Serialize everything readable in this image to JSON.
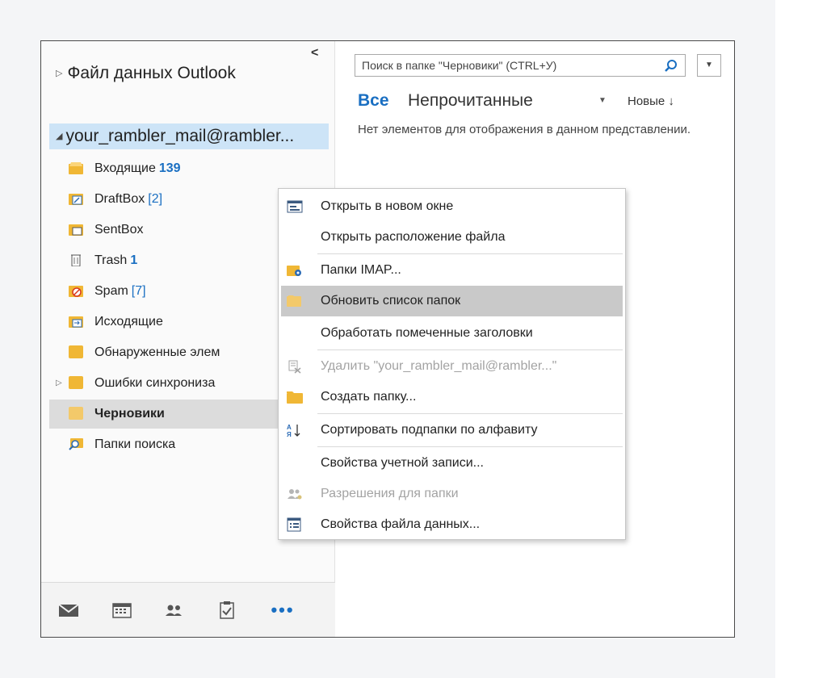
{
  "folder_pane": {
    "data_file": "Файл данных Outlook",
    "account": "your_rambler_mail@rambler...",
    "folders": [
      {
        "name": "Входящие",
        "count": "139"
      },
      {
        "name": "DraftBox",
        "count": "[2]"
      },
      {
        "name": "SentBox",
        "count": ""
      },
      {
        "name": "Trash",
        "count": "1"
      },
      {
        "name": "Spam",
        "count": "[7]"
      },
      {
        "name": "Исходящие",
        "count": ""
      },
      {
        "name": "Обнаруженные элем",
        "count": ""
      },
      {
        "name": "Ошибки синхрониза",
        "count": ""
      },
      {
        "name": "Черновики",
        "count": ""
      },
      {
        "name": "Папки поиска",
        "count": ""
      }
    ],
    "nav": [
      "mail-icon",
      "calendar-icon",
      "people-icon",
      "tasks-icon",
      "more-icon"
    ],
    "nav_more": "•••"
  },
  "content": {
    "search_placeholder": "Поиск в папке \"Черновики\" (CTRL+У)",
    "filter_all": "Все",
    "filter_unread": "Непрочитанные",
    "sort_label": "Новые ↓",
    "empty_message": "Нет элементов для отображения в данном представлении."
  },
  "context_menu": [
    {
      "label": "Открыть в новом окне",
      "icon": "open-window-icon",
      "enabled": true
    },
    {
      "label": "Открыть расположение файла",
      "icon": "",
      "enabled": true
    },
    {
      "label": "Папки IMAP...",
      "icon": "imap-folders-icon",
      "enabled": true
    },
    {
      "label": "Обновить список папок",
      "icon": "refresh-folders-icon",
      "enabled": true,
      "highlighted": true
    },
    {
      "label": "Обработать помеченные заголовки",
      "icon": "",
      "enabled": true
    },
    {
      "label": "Удалить \"your_rambler_mail@rambler...\"",
      "icon": "delete-icon",
      "enabled": false
    },
    {
      "label": "Создать папку...",
      "icon": "new-folder-icon",
      "enabled": true
    },
    {
      "label": "Сортировать подпапки по алфавиту",
      "icon": "sort-az-icon",
      "enabled": true
    },
    {
      "label": "Свойства учетной записи...",
      "icon": "",
      "enabled": true
    },
    {
      "label": "Разрешения для папки",
      "icon": "permissions-icon",
      "enabled": false
    },
    {
      "label": "Свойства файла данных...",
      "icon": "data-file-properties-icon",
      "enabled": true
    }
  ],
  "colors": {
    "accent": "#1a6fc2",
    "selection": "#cde4f7",
    "folder_icon": "#f0b735"
  }
}
